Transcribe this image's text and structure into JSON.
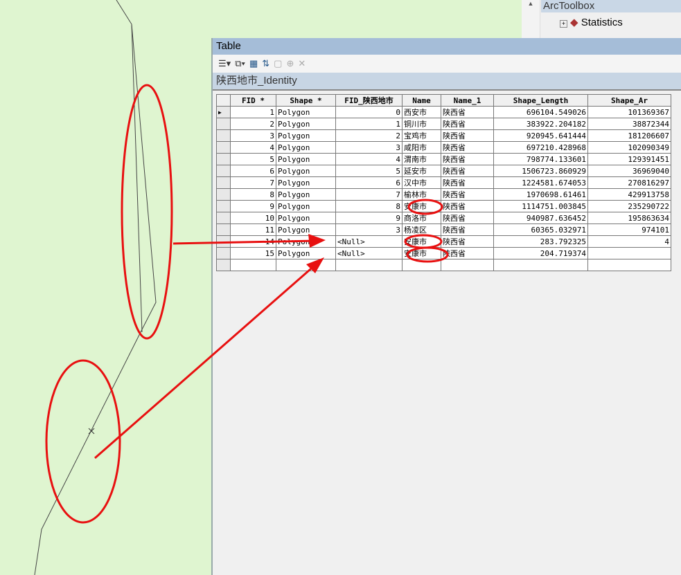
{
  "toolbox": {
    "title": "ArcToolbox",
    "item": "Statistics",
    "scroll_up": "▲"
  },
  "table_window": {
    "title": "Table",
    "table_name": "陕西地市_Identity",
    "toolbar": [
      "table-options",
      "related-tables",
      "select-by-attributes",
      "switch-selection",
      "clear-selection",
      "zoom-to-selected",
      "delete-selected"
    ]
  },
  "columns": [
    "FID *",
    "Shape *",
    "FID_陕西地市",
    "Name",
    "Name_1",
    "Shape_Length",
    "Shape_Ar"
  ],
  "rows": [
    [
      "1",
      "Polygon",
      "0",
      "西安市",
      "陕西省",
      "696104.549026",
      "101369367"
    ],
    [
      "2",
      "Polygon",
      "1",
      "铜川市",
      "陕西省",
      "383922.204182",
      "38872344"
    ],
    [
      "3",
      "Polygon",
      "2",
      "宝鸡市",
      "陕西省",
      "920945.641444",
      "181206607"
    ],
    [
      "4",
      "Polygon",
      "3",
      "咸阳市",
      "陕西省",
      "697210.428968",
      "102090349"
    ],
    [
      "5",
      "Polygon",
      "4",
      "渭南市",
      "陕西省",
      "798774.133601",
      "129391451"
    ],
    [
      "6",
      "Polygon",
      "5",
      "延安市",
      "陕西省",
      "1506723.860929",
      "36969040"
    ],
    [
      "7",
      "Polygon",
      "6",
      "汉中市",
      "陕西省",
      "1224581.674053",
      "270816297"
    ],
    [
      "8",
      "Polygon",
      "7",
      "榆林市",
      "陕西省",
      "1970698.61461",
      "429913758"
    ],
    [
      "9",
      "Polygon",
      "8",
      "安康市",
      "陕西省",
      "1114751.003845",
      "235290722"
    ],
    [
      "10",
      "Polygon",
      "9",
      "商洛市",
      "陕西省",
      "940987.636452",
      "195863634"
    ],
    [
      "11",
      "Polygon",
      "3",
      "杨凌区",
      "陕西省",
      "60365.032971",
      "974101"
    ],
    [
      "14",
      "Polygon",
      "<Null>",
      "安康市",
      "陕西省",
      "283.792325",
      "4"
    ],
    [
      "15",
      "Polygon",
      "<Null>",
      "安康市",
      "陕西省",
      "204.719374",
      ""
    ]
  ],
  "colors": {
    "map_bg": "#dff5d0",
    "annotation": "#e81010",
    "title_bar": "#a5bdd8"
  }
}
